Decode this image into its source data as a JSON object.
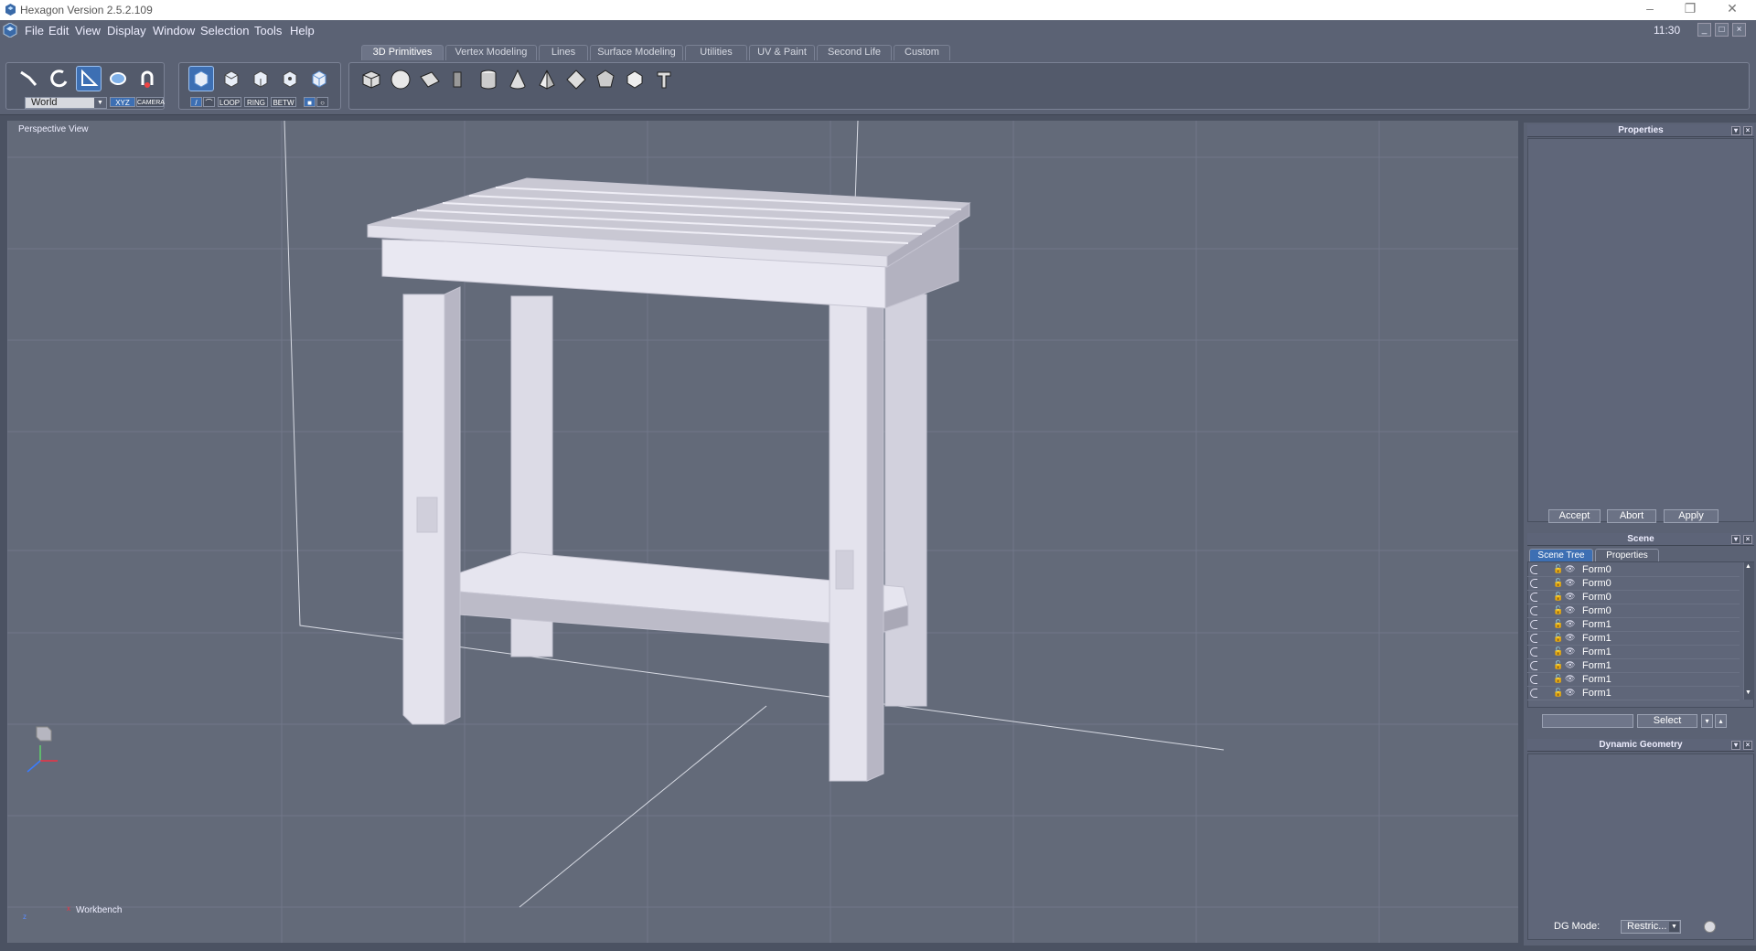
{
  "window": {
    "title": "Hexagon Version 2.5.2.109",
    "controls": [
      "–",
      "❐",
      "✕"
    ]
  },
  "menu": {
    "items": [
      "File",
      "Edit",
      "View",
      "Display",
      "Window",
      "Selection",
      "Tools",
      "Help"
    ],
    "clock": "11:30"
  },
  "tabs": [
    "3D Primitives",
    "Vertex Modeling",
    "Lines",
    "Surface Modeling",
    "Utilities",
    "UV & Paint",
    "Second Life",
    "Custom"
  ],
  "active_tab": "3D Primitives",
  "toolbar": {
    "coord_system": "World",
    "xyz": "XYZ",
    "camera": "CAMERA",
    "loop": "LOOP",
    "ring": "RING",
    "betw": "BETW"
  },
  "viewport": {
    "label": "Perspective View",
    "object_name": "Workbench",
    "axis_x": "x",
    "axis_z": "z"
  },
  "properties_panel": {
    "title": "Properties",
    "accept": "Accept",
    "abort": "Abort",
    "apply": "Apply"
  },
  "scene_panel": {
    "title": "Scene",
    "tabs": [
      "Scene Tree",
      "Properties"
    ],
    "items": [
      "Form0",
      "Form0",
      "Form0",
      "Form0",
      "Form1",
      "Form1",
      "Form1",
      "Form1",
      "Form1",
      "Form1"
    ],
    "select_button": "Select"
  },
  "dynamic_geometry": {
    "title": "Dynamic Geometry",
    "mode_label": "DG Mode:",
    "mode_value": "Restric..."
  },
  "colors": {
    "accent": "#3d6fb3",
    "viewport_bg": "#636a79",
    "panel_bg": "#5b6274",
    "model": "#dcdbe6"
  }
}
